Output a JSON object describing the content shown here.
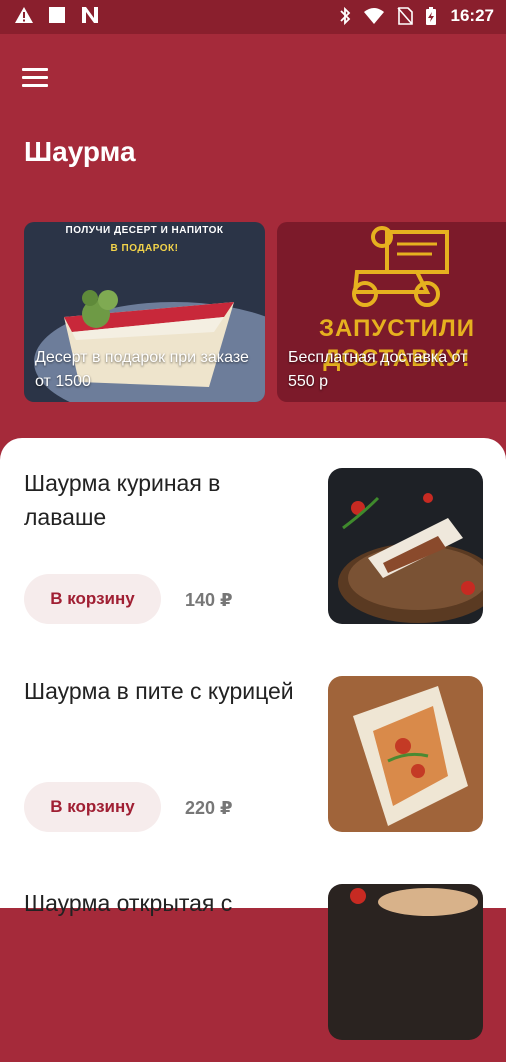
{
  "status_bar": {
    "time": "16:27",
    "left_icons": [
      "warning-icon",
      "square-icon",
      "n-logo-icon"
    ],
    "right_icons": [
      "bluetooth-icon",
      "wifi-icon",
      "no-sim-icon",
      "battery-charging-icon"
    ]
  },
  "header": {
    "title": "Шаурма",
    "menu_icon": "hamburger-menu-icon"
  },
  "promos": [
    {
      "caption": "Десерт в подарок при заказе от 1500",
      "banner_text_lines": [
        "ПОЛУЧИ ДЕСЕРТ И НАПИТОК",
        "В ПОДАРОК!"
      ]
    },
    {
      "caption": "Бесплатная доставка от 550 р",
      "banner_text_lines": [
        "ЗАПУСТИЛИ",
        "ДОСТАВКУ!"
      ]
    }
  ],
  "products": [
    {
      "name": "Шаурма куриная в лаваше",
      "cart_label": "В корзину",
      "price": "140 ₽"
    },
    {
      "name": "Шаурма в пите с курицей",
      "cart_label": "В корзину",
      "price": "220 ₽"
    },
    {
      "name": "Шаурма открытая с",
      "cart_label": "",
      "price": ""
    }
  ],
  "colors": {
    "brand": "#a52a3a",
    "status_bar": "#8a1f2d",
    "cart_button_bg": "#f6ecec",
    "cart_button_text": "#a01f33",
    "banner_yellow": "#e6b11f"
  }
}
